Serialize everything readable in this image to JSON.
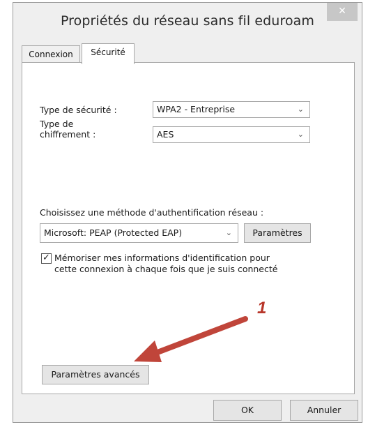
{
  "window": {
    "title": "Propriétés du réseau sans fil eduroam",
    "close_glyph": "✕"
  },
  "tabs": [
    {
      "label": "Connexion",
      "active": false
    },
    {
      "label": "Sécurité",
      "active": true
    }
  ],
  "security": {
    "type_label": "Type de sécurité :",
    "type_value": "WPA2 - Entreprise",
    "encryption_label_line1": "Type de",
    "encryption_label_line2": "chiffrement :",
    "encryption_value": "AES"
  },
  "auth": {
    "method_label": "Choisissez une méthode d'authentification réseau :",
    "method_value": "Microsoft: PEAP (Protected EAP)",
    "params_button": "Paramètres",
    "remember_checked": true,
    "remember_line1": "Mémoriser mes informations d'identification pour",
    "remember_line2": "cette connexion à chaque fois que je suis connecté"
  },
  "advanced_button": "Paramètres avancés",
  "annotation_number": "1",
  "footer": {
    "ok": "OK",
    "cancel": "Annuler"
  },
  "colors": {
    "arrow": "#c0453a",
    "annotation": "#b8362a"
  }
}
